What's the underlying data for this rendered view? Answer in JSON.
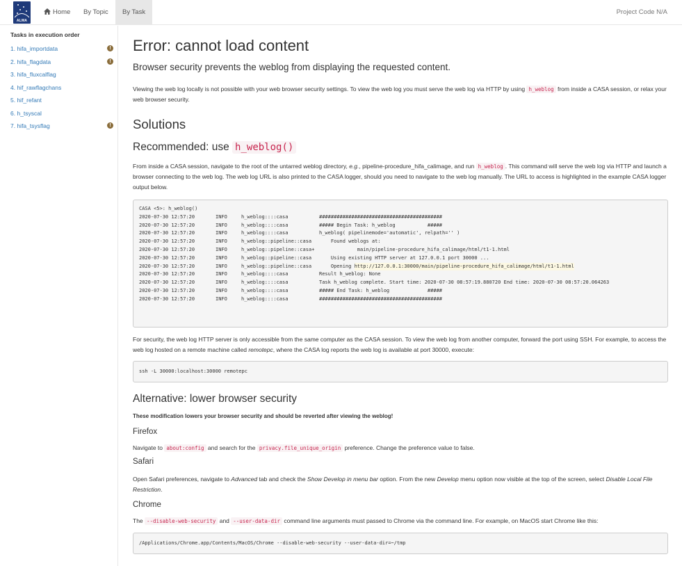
{
  "navbar": {
    "logo_text": "ALMA",
    "home_label": "Home",
    "by_topic_label": "By Topic",
    "by_task_label": "By Task",
    "project_code": "Project Code N/A"
  },
  "sidebar": {
    "heading": "Tasks in execution order",
    "items": [
      {
        "label": "1. hifa_importdata",
        "warning": true
      },
      {
        "label": "2. hifa_flagdata",
        "warning": true
      },
      {
        "label": "3. hifa_fluxcalflag",
        "warning": false
      },
      {
        "label": "4. hif_rawflagchans",
        "warning": false
      },
      {
        "label": "5. hif_refant",
        "warning": false
      },
      {
        "label": "6. h_tsyscal",
        "warning": false
      },
      {
        "label": "7. hifa_tsysflag",
        "warning": true
      }
    ],
    "warning_glyph": "!"
  },
  "main": {
    "title": "Error: cannot load content",
    "lead": "Browser security prevents the weblog from displaying the requested content.",
    "intro_a": "Viewing the web log locally is not possible with your web browser security settings. To view the web log you must serve the web log via HTTP by using ",
    "intro_code": "h_weblog",
    "intro_b": " from inside a CASA session, or relax your web browser security.",
    "solutions_heading": "Solutions",
    "recommended_heading": "Recommended: use ",
    "recommended_code": "h_weblog()",
    "rec_p_a": "From inside a CASA session, navigate to the root of the untarred weblog directory, ",
    "rec_p_eg": "e.g.",
    "rec_p_b": ", pipeline-procedure_hifa_calimage, and run ",
    "rec_p_code": "h_weblog",
    "rec_p_c": ". This command will serve the web log via HTTP and launch a browser connecting to the web log. The web log URL is also printed to the CASA logger, should you need to navigate to the web log manually. The URL to access is highlighted in the example CASA logger output below.",
    "log_prompt": "CASA <5>: h_weblog()",
    "log_lines": [
      {
        "ts": "2020-07-30 12:57:20",
        "lvl": "INFO",
        "src": "h_weblog::::casa",
        "msg": "##########################################"
      },
      {
        "ts": "2020-07-30 12:57:20",
        "lvl": "INFO",
        "src": "h_weblog::::casa",
        "msg": "##### Begin Task: h_weblog           #####"
      },
      {
        "ts": "2020-07-30 12:57:20",
        "lvl": "INFO",
        "src": "h_weblog::::casa",
        "msg": "h_weblog( pipelinemode='automatic', relpath='' )"
      },
      {
        "ts": "2020-07-30 12:57:20",
        "lvl": "INFO",
        "src": "h_weblog::pipeline::casa",
        "msg": "    Found weblogs at:"
      },
      {
        "ts": "2020-07-30 12:57:20",
        "lvl": "INFO",
        "src": "h_weblog::pipeline::casa+",
        "msg": "             main/pipeline-procedure_hifa_calimage/html/t1-1.html"
      },
      {
        "ts": "2020-07-30 12:57:20",
        "lvl": "INFO",
        "src": "h_weblog::pipeline::casa",
        "msg": "    Using existing HTTP server at 127.0.0.1 port 30000 ..."
      },
      {
        "ts": "2020-07-30 12:57:20",
        "lvl": "INFO",
        "src": "h_weblog::pipeline::casa",
        "msg": "    Opening ",
        "hl": "http://127.0.0.1:30000/main/pipeline-procedure_hifa_calimage/html/t1-1.html"
      },
      {
        "ts": "2020-07-30 12:57:20",
        "lvl": "INFO",
        "src": "h_weblog::::casa",
        "msg": "Result h_weblog: None"
      },
      {
        "ts": "2020-07-30 12:57:20",
        "lvl": "INFO",
        "src": "h_weblog::::casa",
        "msg": "Task h_weblog complete. Start time: 2020-07-30 08:57:19.880720 End time: 2020-07-30 08:57:20.064263"
      },
      {
        "ts": "2020-07-30 12:57:20",
        "lvl": "INFO",
        "src": "h_weblog::::casa",
        "msg": "##### End Task: h_weblog             #####"
      },
      {
        "ts": "2020-07-30 12:57:20",
        "lvl": "INFO",
        "src": "h_weblog::::casa",
        "msg": "##########################################"
      }
    ],
    "ssh_p_a": "For security, the web log HTTP server is only accessible from the same computer as the CASA session. To view the web log from another computer, forward the port using SSH. For example, to access the web log hosted on a remote machine called ",
    "ssh_p_em": "remotepc",
    "ssh_p_b": ", where the CASA log reports the web log is available at port 30000, execute:",
    "ssh_cmd": "ssh -L 30000:localhost:30000 remotepc",
    "alt_heading": "Alternative: lower browser security",
    "alt_warning": "These modification lowers your browser security and should be reverted after viewing the weblog!",
    "firefox_heading": "Firefox",
    "ff_a": "Navigate to ",
    "ff_code1": "about:config",
    "ff_b": " and search for the ",
    "ff_code2": "privacy.file_unique_origin",
    "ff_c": " preference. Change the preference value to false.",
    "safari_heading": "Safari",
    "sf_a": "Open Safari preferences, navigate to ",
    "sf_em1": "Advanced",
    "sf_b": " tab and check the ",
    "sf_em2": "Show Develop in menu bar",
    "sf_c": " option. From the new ",
    "sf_em3": "Develop",
    "sf_d": " menu option now visible at the top of the screen, select ",
    "sf_em4": "Disable Local File Restriction",
    "sf_e": ".",
    "chrome_heading": "Chrome",
    "ch_a": "The ",
    "ch_code1": "--disable-web-security",
    "ch_b": " and ",
    "ch_code2": "--user-data-dir",
    "ch_c": " command line arguments must passed to Chrome via the command line. For example, on MacOS start Chrome like this:",
    "chrome_cmd": "/Applications/Chrome.app/Contents/MacOS/Chrome --disable-web-security --user-data-dir=~/tmp"
  },
  "colors": {
    "link": "#337ab7",
    "code": "#c7254e",
    "warning_icon": "#8a6d3b",
    "highlight": "#fcf8e3"
  }
}
